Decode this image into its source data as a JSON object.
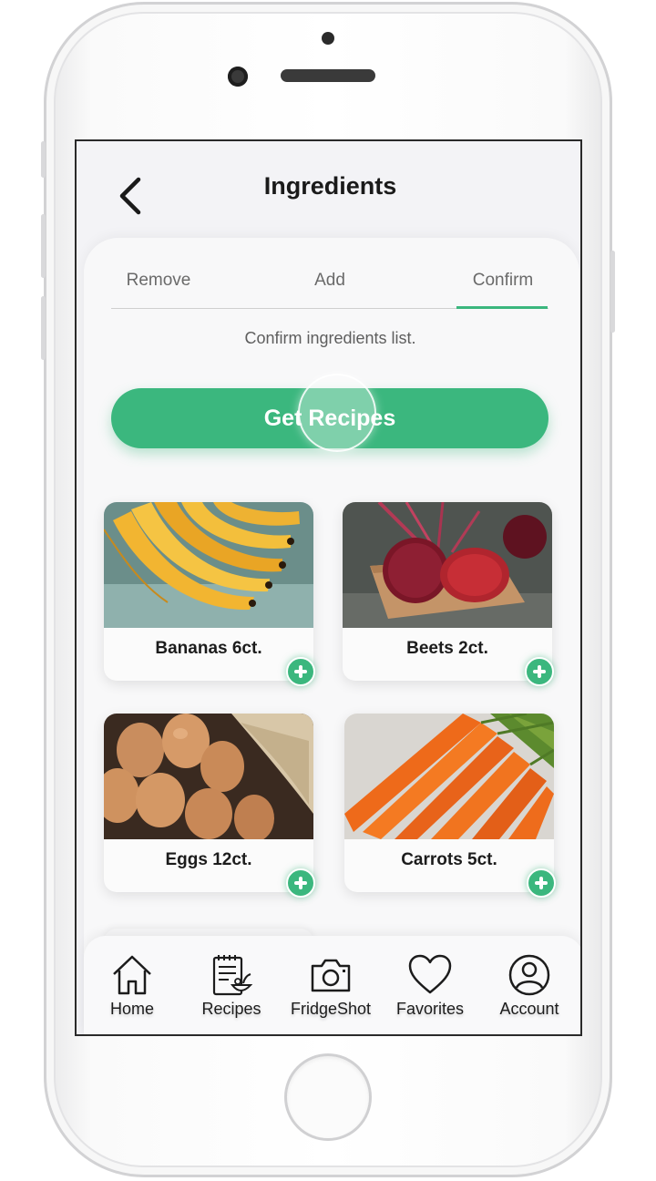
{
  "header": {
    "title": "Ingredients"
  },
  "tabs": [
    {
      "label": "Remove",
      "active": false
    },
    {
      "label": "Add",
      "active": false
    },
    {
      "label": "Confirm",
      "active": true
    }
  ],
  "hint": "Confirm ingredients list.",
  "cta": {
    "label": "Get Recipes",
    "color": "#3bb77e"
  },
  "ingredients": [
    {
      "label": "Bananas 6ct.",
      "image": "bananas"
    },
    {
      "label": "Beets 2ct.",
      "image": "beets"
    },
    {
      "label": "Eggs 12ct.",
      "image": "eggs"
    },
    {
      "label": "Carrots 5ct.",
      "image": "carrots"
    }
  ],
  "nav": [
    {
      "label": "Home",
      "icon": "home-icon"
    },
    {
      "label": "Recipes",
      "icon": "recipes-icon"
    },
    {
      "label": "FridgeShot",
      "icon": "camera-icon"
    },
    {
      "label": "Favorites",
      "icon": "heart-icon"
    },
    {
      "label": "Account",
      "icon": "account-icon"
    }
  ]
}
